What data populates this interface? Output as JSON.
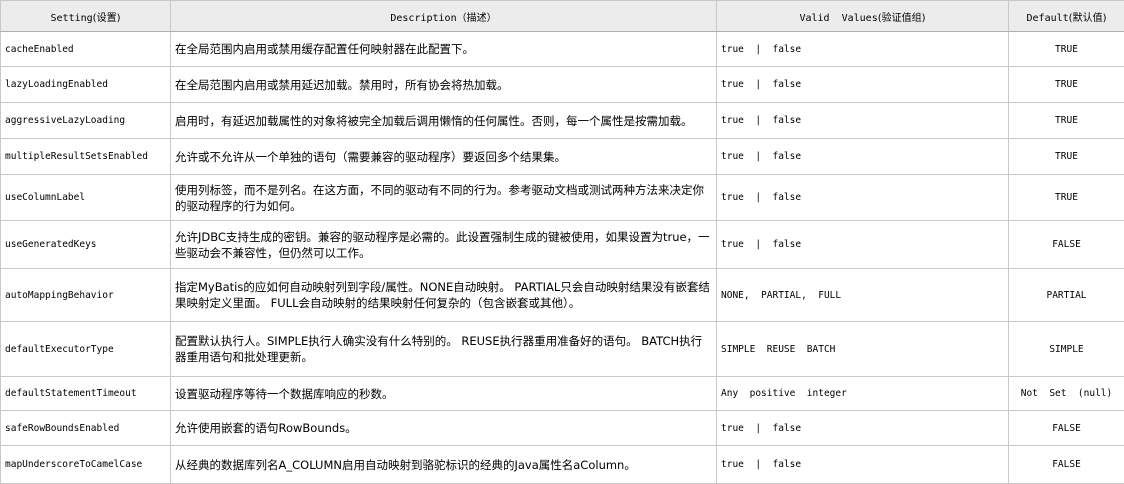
{
  "table": {
    "headers": {
      "setting": "Setting",
      "setting_zh": "(设置)",
      "description": "Description",
      "description_zh": "（描述）",
      "valid_values": "Valid  Values",
      "valid_values_zh": "(验证值组)",
      "default": "Default",
      "default_zh": "(默认值)"
    },
    "rows": [
      {
        "setting": "cacheEnabled",
        "description": "在全局范围内启用或禁用缓存配置任何映射器在此配置下。",
        "valid_values": "true  |  false",
        "default": "TRUE"
      },
      {
        "setting": "lazyLoadingEnabled",
        "description": "在全局范围内启用或禁用延迟加载。禁用时，所有协会将热加载。",
        "valid_values": "true  |  false",
        "default": "TRUE"
      },
      {
        "setting": "aggressiveLazyLoading",
        "description": "启用时，有延迟加载属性的对象将被完全加载后调用懒惰的任何属性。否则，每一个属性是按需加载。",
        "valid_values": "true  |  false",
        "default": "TRUE"
      },
      {
        "setting": "multipleResultSetsEnabled",
        "description": "允许或不允许从一个单独的语句（需要兼容的驱动程序）要返回多个结果集。",
        "valid_values": "true  |  false",
        "default": "TRUE"
      },
      {
        "setting": "useColumnLabel",
        "description": "使用列标签，而不是列名。在这方面，不同的驱动有不同的行为。参考驱动文档或测试两种方法来决定你的驱动程序的行为如何。",
        "valid_values": "true  |  false",
        "default": "TRUE"
      },
      {
        "setting": "useGeneratedKeys",
        "description": "允许JDBC支持生成的密钥。兼容的驱动程序是必需的。此设置强制生成的键被使用，如果设置为true，一些驱动会不兼容性，但仍然可以工作。",
        "valid_values": "true  |  false",
        "default": "FALSE"
      },
      {
        "setting": "autoMappingBehavior",
        "description": "指定MyBatis的应如何自动映射列到字段/属性。NONE自动映射。 PARTIAL只会自动映射结果没有嵌套结果映射定义里面。  FULL会自动映射的结果映射任何复杂的（包含嵌套或其他）。",
        "valid_values": "NONE,  PARTIAL,  FULL",
        "default": "PARTIAL"
      },
      {
        "setting": "defaultExecutorType",
        "description": "配置默认执行人。SIMPLE执行人确实没有什么特别的。  REUSE执行器重用准备好的语句。  BATCH执行器重用语句和批处理更新。",
        "valid_values": "SIMPLE  REUSE  BATCH",
        "default": "SIMPLE"
      },
      {
        "setting": "defaultStatementTimeout",
        "description": "设置驱动程序等待一个数据库响应的秒数。",
        "valid_values": "Any  positive  integer",
        "default": "Not  Set  (null)"
      },
      {
        "setting": "safeRowBoundsEnabled",
        "description": "允许使用嵌套的语句RowBounds。",
        "valid_values": "true  |  false",
        "default": "FALSE"
      },
      {
        "setting": "mapUnderscoreToCamelCase",
        "description": "从经典的数据库列名A_COLUMN启用自动映射到骆驼标识的经典的Java属性名aColumn。",
        "valid_values": "true  |  false",
        "default": "FALSE"
      }
    ]
  }
}
